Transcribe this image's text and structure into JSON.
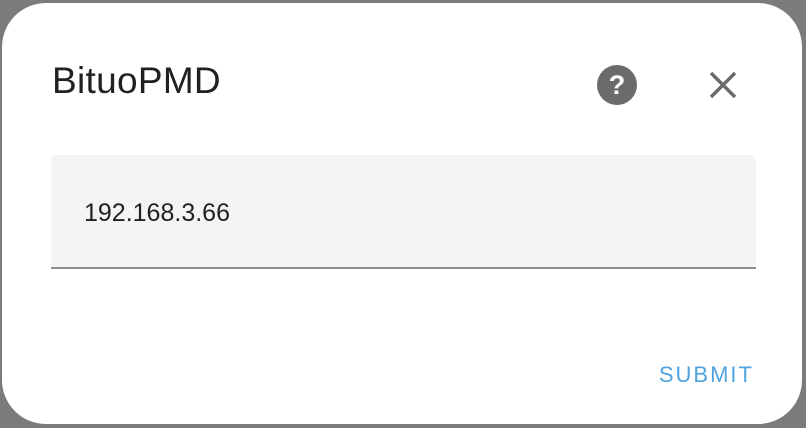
{
  "dialog": {
    "title": "BituoPMD",
    "help_icon": "help-circle-icon",
    "close_icon": "close-icon",
    "host_input": {
      "value": "192.168.3.66",
      "placeholder": ""
    },
    "submit_label": "SUBMIT"
  },
  "colors": {
    "accent": "#4fa3e0",
    "icon": "#6b6b6b",
    "field_bg": "#f4f4f4",
    "text": "#212121"
  }
}
